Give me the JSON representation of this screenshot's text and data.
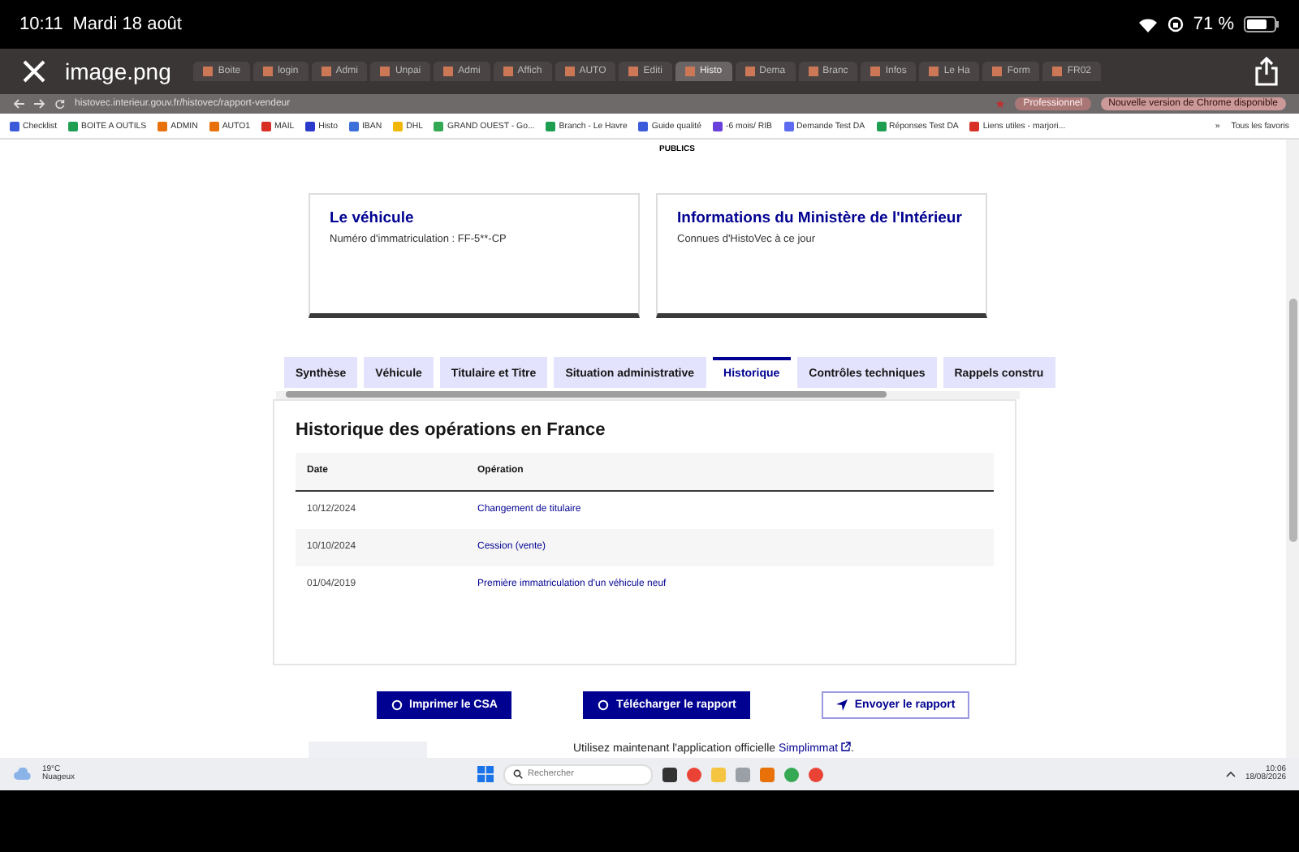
{
  "status_bar": {
    "time": "10:11",
    "date": "Mardi 18 août",
    "battery": "71 %"
  },
  "viewer": {
    "title": "image.png"
  },
  "browser": {
    "tabs": [
      {
        "label": "Boite",
        "selected": false
      },
      {
        "label": "login",
        "selected": false
      },
      {
        "label": "Admi",
        "selected": false
      },
      {
        "label": "Unpai",
        "selected": false
      },
      {
        "label": "Admi",
        "selected": false
      },
      {
        "label": "Affich",
        "selected": false
      },
      {
        "label": "AUTO",
        "selected": false
      },
      {
        "label": "Editi",
        "selected": false
      },
      {
        "label": "Histo",
        "selected": true
      },
      {
        "label": "Dema",
        "selected": false
      },
      {
        "label": "Branc",
        "selected": false
      },
      {
        "label": "Infos",
        "selected": false
      },
      {
        "label": "Le Ha",
        "selected": false
      },
      {
        "label": "Form",
        "selected": false
      },
      {
        "label": "FR02",
        "selected": false
      }
    ],
    "url": "histovec.interieur.gouv.fr/histovec/rapport-vendeur",
    "profile": "Professionnel",
    "update_notice": "Nouvelle version de Chrome disponible",
    "bookmarks": [
      {
        "label": "Checklist",
        "color": "#3b5bdb"
      },
      {
        "label": "BOITE A OUTILS",
        "color": "#1e9e50"
      },
      {
        "label": "ADMIN",
        "color": "#e8710a"
      },
      {
        "label": "AUTO1",
        "color": "#e8710a"
      },
      {
        "label": "MAIL",
        "color": "#d93025"
      },
      {
        "label": "Histo",
        "color": "#2a3bcc"
      },
      {
        "label": "IBAN",
        "color": "#3b6fd9"
      },
      {
        "label": "DHL",
        "color": "#f2b705"
      },
      {
        "label": "GRAND OUEST - Go...",
        "color": "#34a853"
      },
      {
        "label": "Branch - Le Havre",
        "color": "#1e9e50"
      },
      {
        "label": "Guide qualité",
        "color": "#3b5bdb"
      },
      {
        "label": "-6 mois/ RIB",
        "color": "#6741d9"
      },
      {
        "label": "Demande Test DA",
        "color": "#5c6bf0"
      },
      {
        "label": "Réponses Test DA",
        "color": "#1e9e50"
      },
      {
        "label": "Liens utiles - marjori...",
        "color": "#d93025"
      }
    ],
    "more": "»",
    "all_bookmarks": "Tous les favoris"
  },
  "page": {
    "logo": "PUBLICS",
    "cards": [
      {
        "title": "Le véhicule",
        "text": "Numéro d'immatriculation : FF-5**-CP"
      },
      {
        "title": "Informations du Ministère de l'Intérieur",
        "text": "Connues d'HistoVec à ce jour"
      }
    ],
    "tabs": [
      {
        "label": "Synthèse",
        "selected": false
      },
      {
        "label": "Véhicule",
        "selected": false
      },
      {
        "label": "Titulaire et Titre",
        "selected": false
      },
      {
        "label": "Situation administrative",
        "selected": false
      },
      {
        "label": "Historique",
        "selected": true
      },
      {
        "label": "Contrôles techniques",
        "selected": false
      },
      {
        "label": "Rappels constru",
        "selected": false
      }
    ],
    "section_title": "Historique des opérations en France",
    "table": {
      "columns": [
        "Date",
        "Opération"
      ],
      "rows": [
        {
          "date": "10/12/2024",
          "operation": "Changement de titulaire"
        },
        {
          "date": "10/10/2024",
          "operation": "Cession (vente)"
        },
        {
          "date": "01/04/2019",
          "operation": "Première immatriculation d'un véhicule neuf"
        }
      ]
    },
    "buttons": [
      {
        "label": "Imprimer le CSA",
        "kind": "primary"
      },
      {
        "label": "Télécharger le rapport",
        "kind": "primary"
      },
      {
        "label": "Envoyer le rapport",
        "kind": "secondary"
      }
    ],
    "footer_text": "Utilisez maintenant l'application officielle",
    "footer_link": "Simplimmat",
    "footer_end": "."
  },
  "taskbar": {
    "temperature": "19°C",
    "weather": "Nuageux",
    "search_placeholder": "Rechercher",
    "time": "10:06",
    "date": "18/08/2026"
  }
}
